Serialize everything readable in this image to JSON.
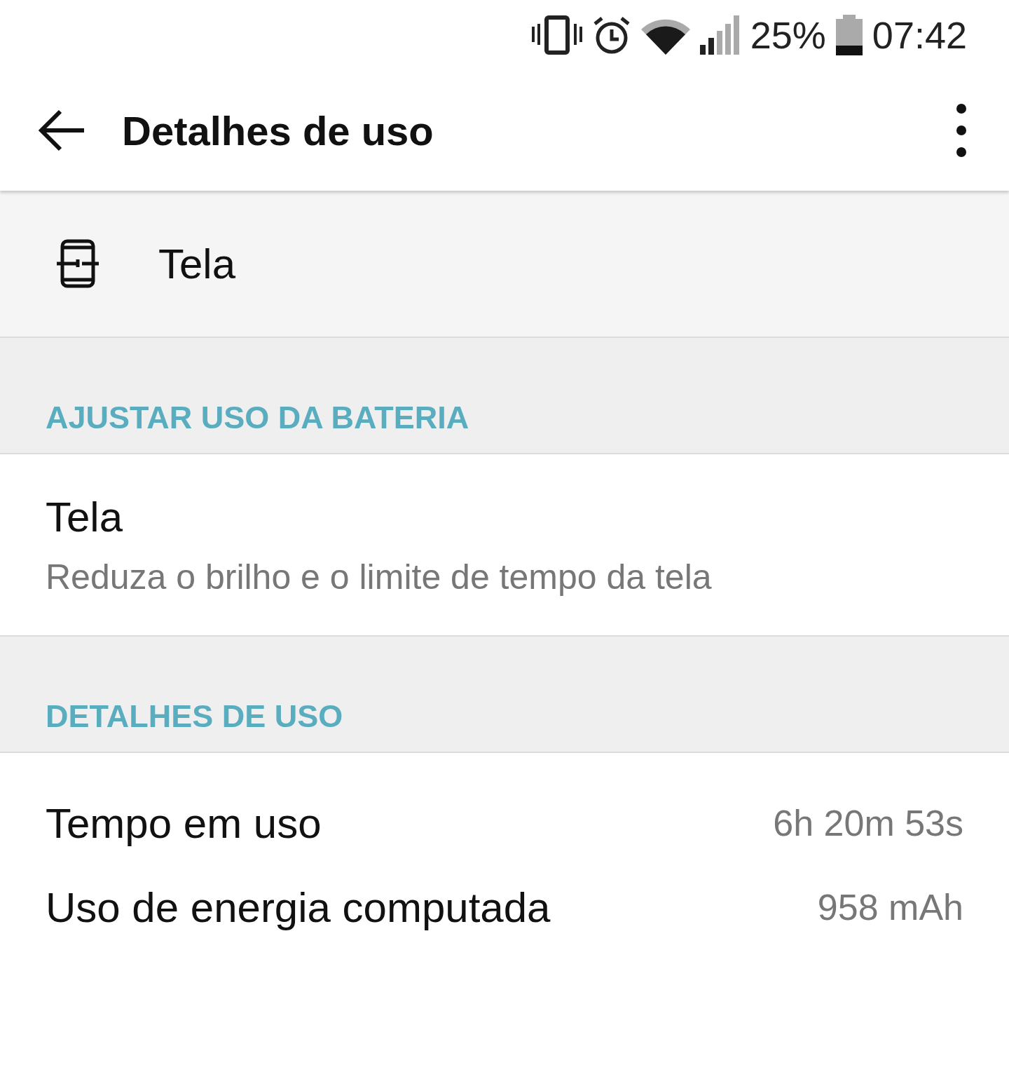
{
  "status_bar": {
    "battery_percent": "25%",
    "time": "07:42"
  },
  "app_bar": {
    "title": "Detalhes de uso"
  },
  "app_header": {
    "name": "Tela"
  },
  "sections": [
    {
      "title": "AJUSTAR USO DA BATERIA",
      "items": [
        {
          "kind": "suggestion",
          "title": "Tela",
          "subtitle": "Reduza o brilho e o limite de tempo da tela"
        }
      ]
    },
    {
      "title": "DETALHES DE USO",
      "items": [
        {
          "kind": "stat",
          "label": "Tempo em uso",
          "value": "6h 20m 53s"
        },
        {
          "kind": "stat",
          "label": "Uso de energia computada",
          "value": "958 mAh"
        }
      ]
    }
  ]
}
